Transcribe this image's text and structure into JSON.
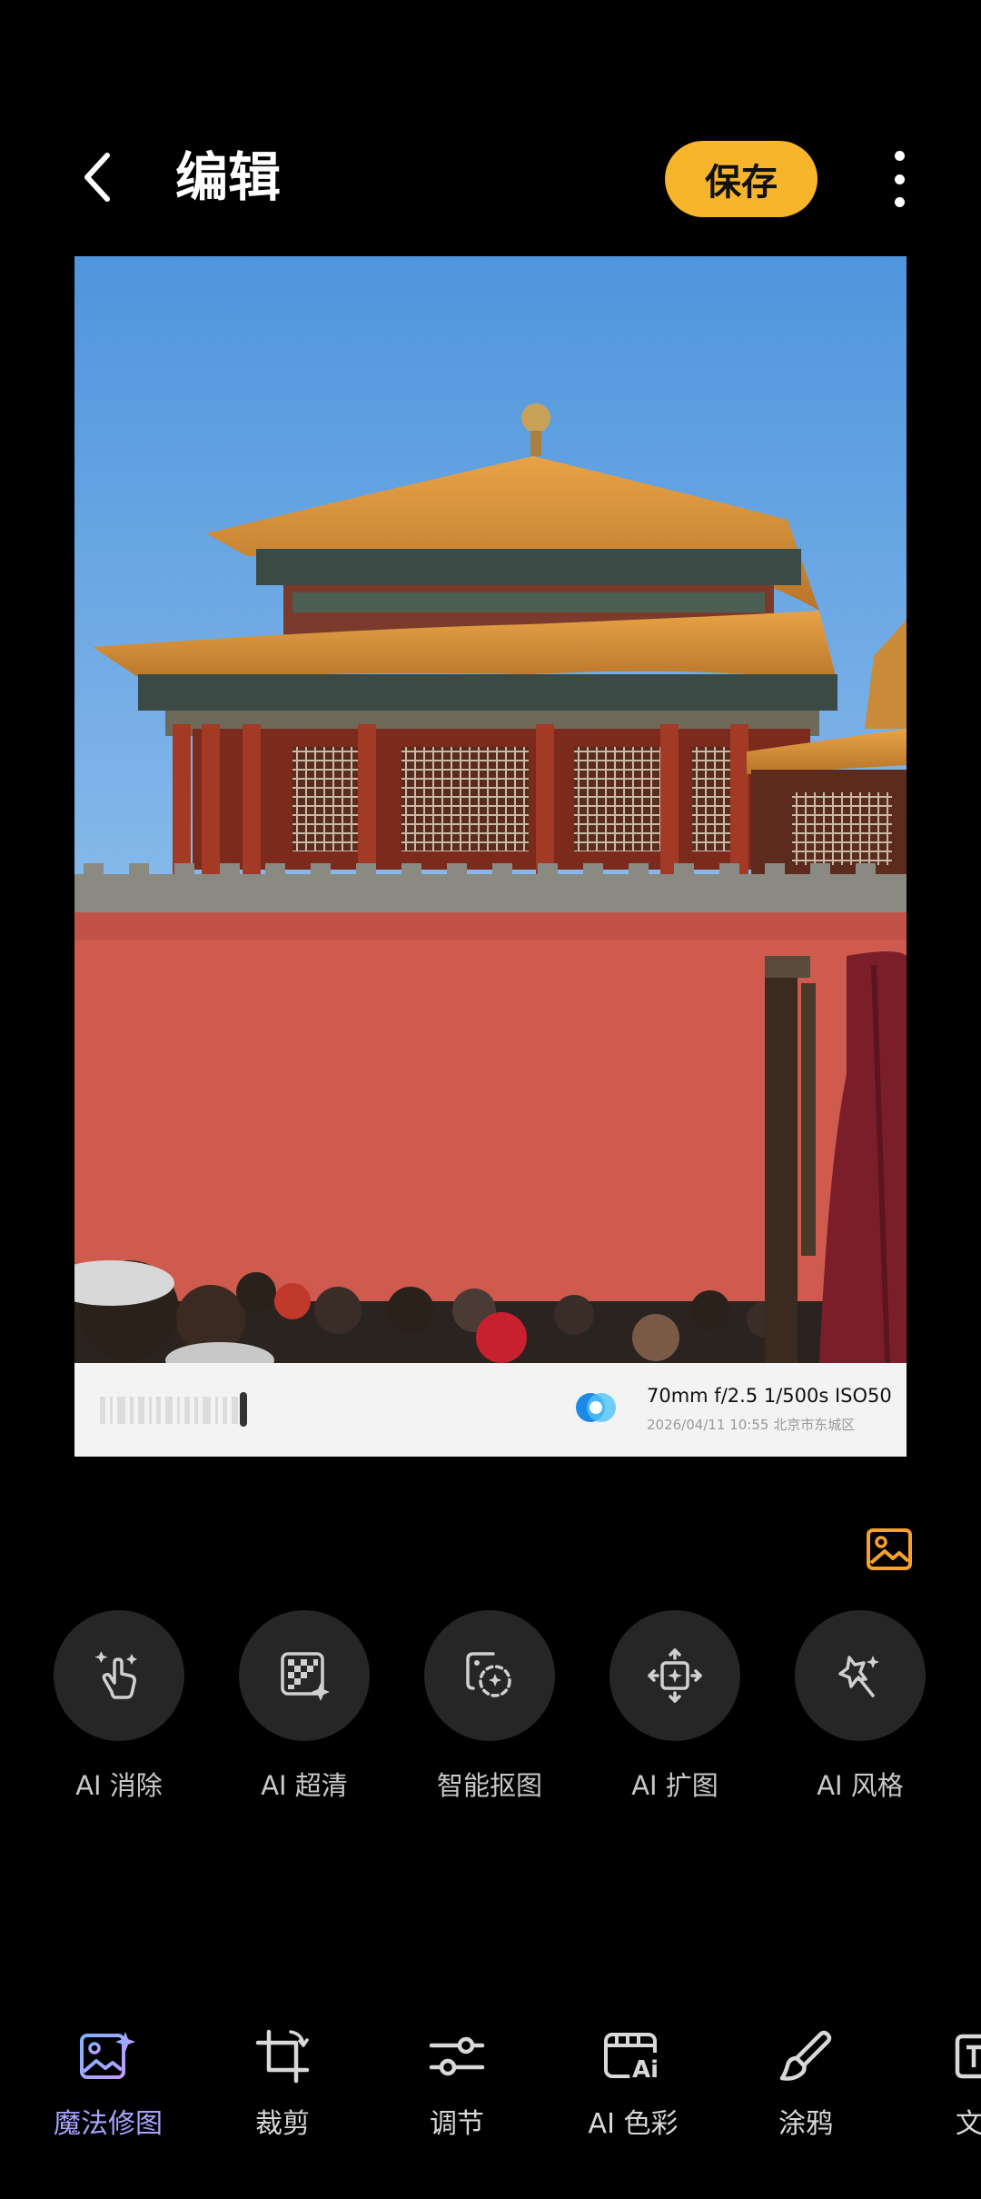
{
  "header": {
    "title": "编辑",
    "save_label": "保存"
  },
  "photo": {
    "watermark": {
      "specs": "70mm  f/2.5  1/500s  ISO50",
      "meta": "2026/04/11 10:55  北京市东城区"
    }
  },
  "ai_tools": [
    {
      "label": "AI 消除",
      "icon": "ai-erase-icon"
    },
    {
      "label": "AI 超清",
      "icon": "ai-enhance-icon"
    },
    {
      "label": "智能抠图",
      "icon": "smart-cutout-icon"
    },
    {
      "label": "AI 扩图",
      "icon": "ai-expand-icon"
    },
    {
      "label": "AI 风格",
      "icon": "ai-style-icon"
    }
  ],
  "bottom_nav": [
    {
      "label": "魔法修图",
      "icon": "magic-edit-icon",
      "active": true
    },
    {
      "label": "裁剪",
      "icon": "crop-icon"
    },
    {
      "label": "调节",
      "icon": "adjust-icon"
    },
    {
      "label": "AI 色彩",
      "icon": "ai-color-icon"
    },
    {
      "label": "涂鸦",
      "icon": "doodle-icon"
    },
    {
      "label": "文",
      "icon": "text-icon"
    }
  ],
  "colors": {
    "accent": "#f7b52b",
    "active_tab": "#a9a4ff",
    "tool_circle": "#262626",
    "background": "#000000"
  }
}
